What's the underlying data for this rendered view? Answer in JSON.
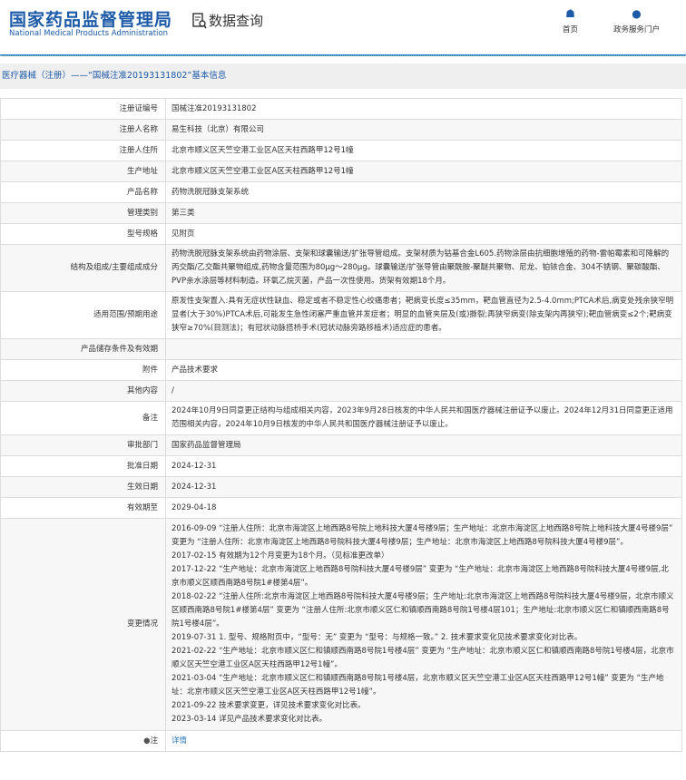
{
  "header": {
    "logo_cn": "国家药品监督管理局",
    "logo_en": "National Medical Products Administration",
    "data_query": "数据查询",
    "nav": [
      {
        "label": "首页",
        "icon": "home-icon"
      },
      {
        "label": "政务服务门户",
        "icon": "user-icon"
      }
    ]
  },
  "breadcrumb": "医疗器械（注册）——“国械注准20193131802”基本信息",
  "rows": [
    {
      "label": "注册证编号",
      "value": "国械注准20193131802"
    },
    {
      "label": "注册人名称",
      "value": "易生科技（北京）有限公司"
    },
    {
      "label": "注册人住所",
      "value": "北京市顺义区天竺空港工业区A区天柱西路甲12号1幢"
    },
    {
      "label": "生产地址",
      "value": "北京市顺义区天竺空港工业区A区天柱西路甲12号1幢"
    },
    {
      "label": "产品名称",
      "value": "药物洗脱冠脉支架系统"
    },
    {
      "label": "管理类别",
      "value": "第三类"
    },
    {
      "label": "型号规格",
      "value": "见附页"
    },
    {
      "label": "结构及组成/主要组成成分",
      "value": "药物洗脱冠脉支架系统由药物涂层、支架和球囊输送/扩张导管组成。支架材质为钴基合金L605.药物涂层由抗细胞增殖的药物-雷帕霉素和可降解的丙交酯/乙交酯共聚物组成,药物含量范围为80μg～280μg。球囊输送/扩张导管由聚酰胺-聚醚共聚物、尼龙、铂铱合金、304不锈钢、聚碳酸酯、PVP亲水涂层等材料制造。环氧乙烷灭菌，产品一次性使用。货架有效期18个月。"
    },
    {
      "label": "适用范围/预期用途",
      "value": "原发性支架置入:具有无症状性缺血、稳定或者不稳定性心绞痛患者；靶病变长度≤35mm，靶血管直径为2.5-4.0mm;PTCA术后,病变处残余狭窄明显者(大于30%)PTCA术后,可能发生急性闭塞严重血管并发症者；明显的血管夹层及(或)撕裂;再狭窄病变(除支架内再狭窄);靶血管病变≤2个;靶病变狭窄≥70%(目测法)；有冠状动脉搭桥手术(冠状动脉旁路移植术)适应症的患者。"
    },
    {
      "label": "产品储存条件及有效期",
      "value": ""
    },
    {
      "label": "附件",
      "value": "产品技术要求"
    },
    {
      "label": "其他内容",
      "value": "/"
    },
    {
      "label": "备注",
      "value": "2024年10月9日同意更正结构与组成相关内容，2023年9月28日核发的中华人民共和国医疗器械注册证予以废止。2024年12月31日同意更正适用范围相关内容，2024年10月9日核发的中华人民共和国医疗器械注册证予以废止。"
    },
    {
      "label": "审批部门",
      "value": "国家药品监督管理局"
    },
    {
      "label": "批准日期",
      "value": "2024-12-31"
    },
    {
      "label": "生效日期",
      "value": "2024-12-31"
    },
    {
      "label": "有效期至",
      "value": "2029-04-18"
    }
  ],
  "changes": {
    "label": "变更情况",
    "items": [
      "2016-09-09 “注册人住所：北京市海淀区上地西路8号院上地科技大厦4号楼9层；生产地址：北京市海淀区上地西路8号院上地科技大厦4号楼9层” 变更为 “注册人住所：北京市海淀区上地西路8号院科技大厦4号楼9层；生产地址：北京市海淀区上地西路8号院科技大厦4号楼9层”。",
      "2017-02-15 有效期为12个月变更为18个月。（见标准更改单）",
      "2017-12-22 “生产地址：北京市海淀区上地西路8号院科技大厦4号楼9层” 变更为 “生产地址：北京市海淀区上地西路8号院科技大厦4号楼9层,北京市顺义区顺西南路8号院1#楼第4层”。",
      "2018-02-22 “注册人住所:北京市海淀区上地西路8号院科技大厦4号楼9层；生产地址:北京市海淀区上地西路8号院科技大厦4号楼9层，北京市顺义区顺西南路8号院1#楼第4层” 变更为 “注册人住所:北京市顺义区仁和镇顺西南路8号院1号楼4层101；生产地址:北京市顺义区仁和镇顺西南路8号院1号楼4层”。",
      "2019-07-31 1. 型号、规格附页中，“型号：无” 变更为 “型号：与规格一致。” 2. 技术要求变化见技术要求变化对比表。",
      "2021-02-22 “生产地址：北京市顺义区仁和镇顺西南路8号院1号楼4层” 变更为 “生产地址：北京市顺义区仁和镇顺西南路8号院1号楼4层，北京市顺义区天竺空港工业区A区天柱西路甲12号1幢”。",
      "2021-03-04 “生产地址：北京市顺义区仁和镇顺西南路8号院1号楼4层，北京市顺义区天竺空港工业区A区天柱西路甲12号1幢” 变更为 “生产地址：北京市顺义区天竺空港工业区A区天柱西路甲12号1幢”。",
      "2021-09-22 技术要求变更，详见技术要求变化对比表。",
      "2023-03-14 详见产品技术要求变化对比表。"
    ]
  },
  "note": {
    "label": "注",
    "link": "详情"
  }
}
